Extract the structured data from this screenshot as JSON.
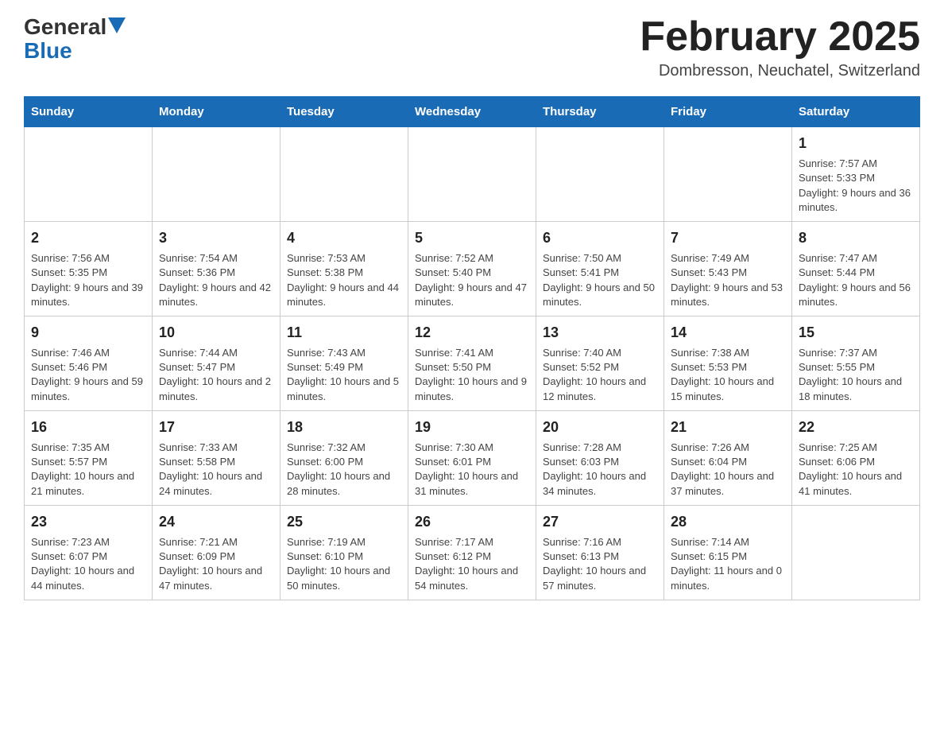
{
  "header": {
    "logo_general": "General",
    "logo_blue": "Blue",
    "month_title": "February 2025",
    "location": "Dombresson, Neuchatel, Switzerland"
  },
  "days_of_week": [
    "Sunday",
    "Monday",
    "Tuesday",
    "Wednesday",
    "Thursday",
    "Friday",
    "Saturday"
  ],
  "weeks": [
    {
      "days": [
        {
          "number": "",
          "info": ""
        },
        {
          "number": "",
          "info": ""
        },
        {
          "number": "",
          "info": ""
        },
        {
          "number": "",
          "info": ""
        },
        {
          "number": "",
          "info": ""
        },
        {
          "number": "",
          "info": ""
        },
        {
          "number": "1",
          "info": "Sunrise: 7:57 AM\nSunset: 5:33 PM\nDaylight: 9 hours and 36 minutes."
        }
      ]
    },
    {
      "days": [
        {
          "number": "2",
          "info": "Sunrise: 7:56 AM\nSunset: 5:35 PM\nDaylight: 9 hours and 39 minutes."
        },
        {
          "number": "3",
          "info": "Sunrise: 7:54 AM\nSunset: 5:36 PM\nDaylight: 9 hours and 42 minutes."
        },
        {
          "number": "4",
          "info": "Sunrise: 7:53 AM\nSunset: 5:38 PM\nDaylight: 9 hours and 44 minutes."
        },
        {
          "number": "5",
          "info": "Sunrise: 7:52 AM\nSunset: 5:40 PM\nDaylight: 9 hours and 47 minutes."
        },
        {
          "number": "6",
          "info": "Sunrise: 7:50 AM\nSunset: 5:41 PM\nDaylight: 9 hours and 50 minutes."
        },
        {
          "number": "7",
          "info": "Sunrise: 7:49 AM\nSunset: 5:43 PM\nDaylight: 9 hours and 53 minutes."
        },
        {
          "number": "8",
          "info": "Sunrise: 7:47 AM\nSunset: 5:44 PM\nDaylight: 9 hours and 56 minutes."
        }
      ]
    },
    {
      "days": [
        {
          "number": "9",
          "info": "Sunrise: 7:46 AM\nSunset: 5:46 PM\nDaylight: 9 hours and 59 minutes."
        },
        {
          "number": "10",
          "info": "Sunrise: 7:44 AM\nSunset: 5:47 PM\nDaylight: 10 hours and 2 minutes."
        },
        {
          "number": "11",
          "info": "Sunrise: 7:43 AM\nSunset: 5:49 PM\nDaylight: 10 hours and 5 minutes."
        },
        {
          "number": "12",
          "info": "Sunrise: 7:41 AM\nSunset: 5:50 PM\nDaylight: 10 hours and 9 minutes."
        },
        {
          "number": "13",
          "info": "Sunrise: 7:40 AM\nSunset: 5:52 PM\nDaylight: 10 hours and 12 minutes."
        },
        {
          "number": "14",
          "info": "Sunrise: 7:38 AM\nSunset: 5:53 PM\nDaylight: 10 hours and 15 minutes."
        },
        {
          "number": "15",
          "info": "Sunrise: 7:37 AM\nSunset: 5:55 PM\nDaylight: 10 hours and 18 minutes."
        }
      ]
    },
    {
      "days": [
        {
          "number": "16",
          "info": "Sunrise: 7:35 AM\nSunset: 5:57 PM\nDaylight: 10 hours and 21 minutes."
        },
        {
          "number": "17",
          "info": "Sunrise: 7:33 AM\nSunset: 5:58 PM\nDaylight: 10 hours and 24 minutes."
        },
        {
          "number": "18",
          "info": "Sunrise: 7:32 AM\nSunset: 6:00 PM\nDaylight: 10 hours and 28 minutes."
        },
        {
          "number": "19",
          "info": "Sunrise: 7:30 AM\nSunset: 6:01 PM\nDaylight: 10 hours and 31 minutes."
        },
        {
          "number": "20",
          "info": "Sunrise: 7:28 AM\nSunset: 6:03 PM\nDaylight: 10 hours and 34 minutes."
        },
        {
          "number": "21",
          "info": "Sunrise: 7:26 AM\nSunset: 6:04 PM\nDaylight: 10 hours and 37 minutes."
        },
        {
          "number": "22",
          "info": "Sunrise: 7:25 AM\nSunset: 6:06 PM\nDaylight: 10 hours and 41 minutes."
        }
      ]
    },
    {
      "days": [
        {
          "number": "23",
          "info": "Sunrise: 7:23 AM\nSunset: 6:07 PM\nDaylight: 10 hours and 44 minutes."
        },
        {
          "number": "24",
          "info": "Sunrise: 7:21 AM\nSunset: 6:09 PM\nDaylight: 10 hours and 47 minutes."
        },
        {
          "number": "25",
          "info": "Sunrise: 7:19 AM\nSunset: 6:10 PM\nDaylight: 10 hours and 50 minutes."
        },
        {
          "number": "26",
          "info": "Sunrise: 7:17 AM\nSunset: 6:12 PM\nDaylight: 10 hours and 54 minutes."
        },
        {
          "number": "27",
          "info": "Sunrise: 7:16 AM\nSunset: 6:13 PM\nDaylight: 10 hours and 57 minutes."
        },
        {
          "number": "28",
          "info": "Sunrise: 7:14 AM\nSunset: 6:15 PM\nDaylight: 11 hours and 0 minutes."
        },
        {
          "number": "",
          "info": ""
        }
      ]
    }
  ]
}
